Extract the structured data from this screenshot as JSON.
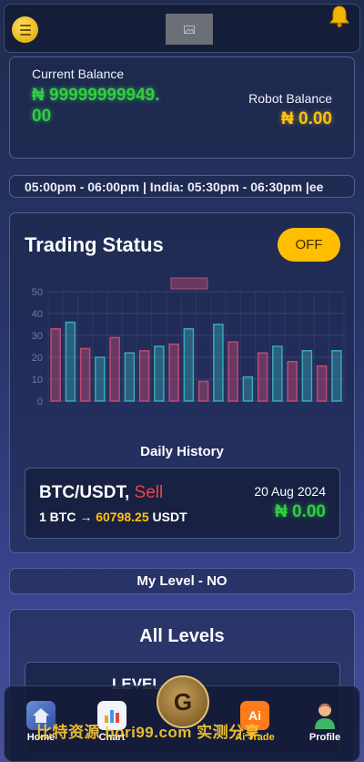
{
  "header": {
    "menu_icon": "menu-icon",
    "logo_icon": "image-icon",
    "bell_icon": "bell-icon"
  },
  "balances": {
    "current_label": "Current Balance",
    "current_value": "₦ 99999999949.00",
    "robot_label": "Robot Balance",
    "robot_value": "₦ 0.00"
  },
  "ticker": {
    "text": "05:00pm - 06:00pm | India: 05:30pm - 06:30pm |ee"
  },
  "trading": {
    "title": "Trading Status",
    "toggle_label": "OFF",
    "daily_label": "Daily History"
  },
  "chart_data": {
    "type": "bar",
    "ylim": [
      0,
      50
    ],
    "yticks": [
      "0",
      "10",
      "20",
      "30",
      "40",
      "50"
    ],
    "series": [
      {
        "color": "#c24a72",
        "values": [
          33,
          24,
          29,
          23,
          26,
          9,
          27,
          22,
          18,
          16
        ]
      },
      {
        "color": "#3aa9b6",
        "values": [
          36,
          20,
          22,
          25,
          33,
          35,
          11,
          25,
          23,
          23
        ]
      }
    ]
  },
  "trade": {
    "pair": "BTC/USDT,",
    "side": "Sell",
    "conv_prefix": "1 BTC → ",
    "price": "60798.25",
    "conv_suffix": " USDT",
    "date": "20 Aug 2024",
    "amount": "₦ 0.00"
  },
  "level": {
    "text": "My Level - NO"
  },
  "levels": {
    "title": "All Levels",
    "inner_label": "LEVEL"
  },
  "nav": [
    {
      "label": "Home",
      "icon": "home-icon"
    },
    {
      "label": "Chart",
      "icon": "bar-chart-icon"
    },
    {
      "label": "Ai Trade",
      "icon": "ai-icon"
    },
    {
      "label": "Profile",
      "icon": "user-icon"
    }
  ],
  "watermark": "比特资源 bori99.com 实测分享"
}
